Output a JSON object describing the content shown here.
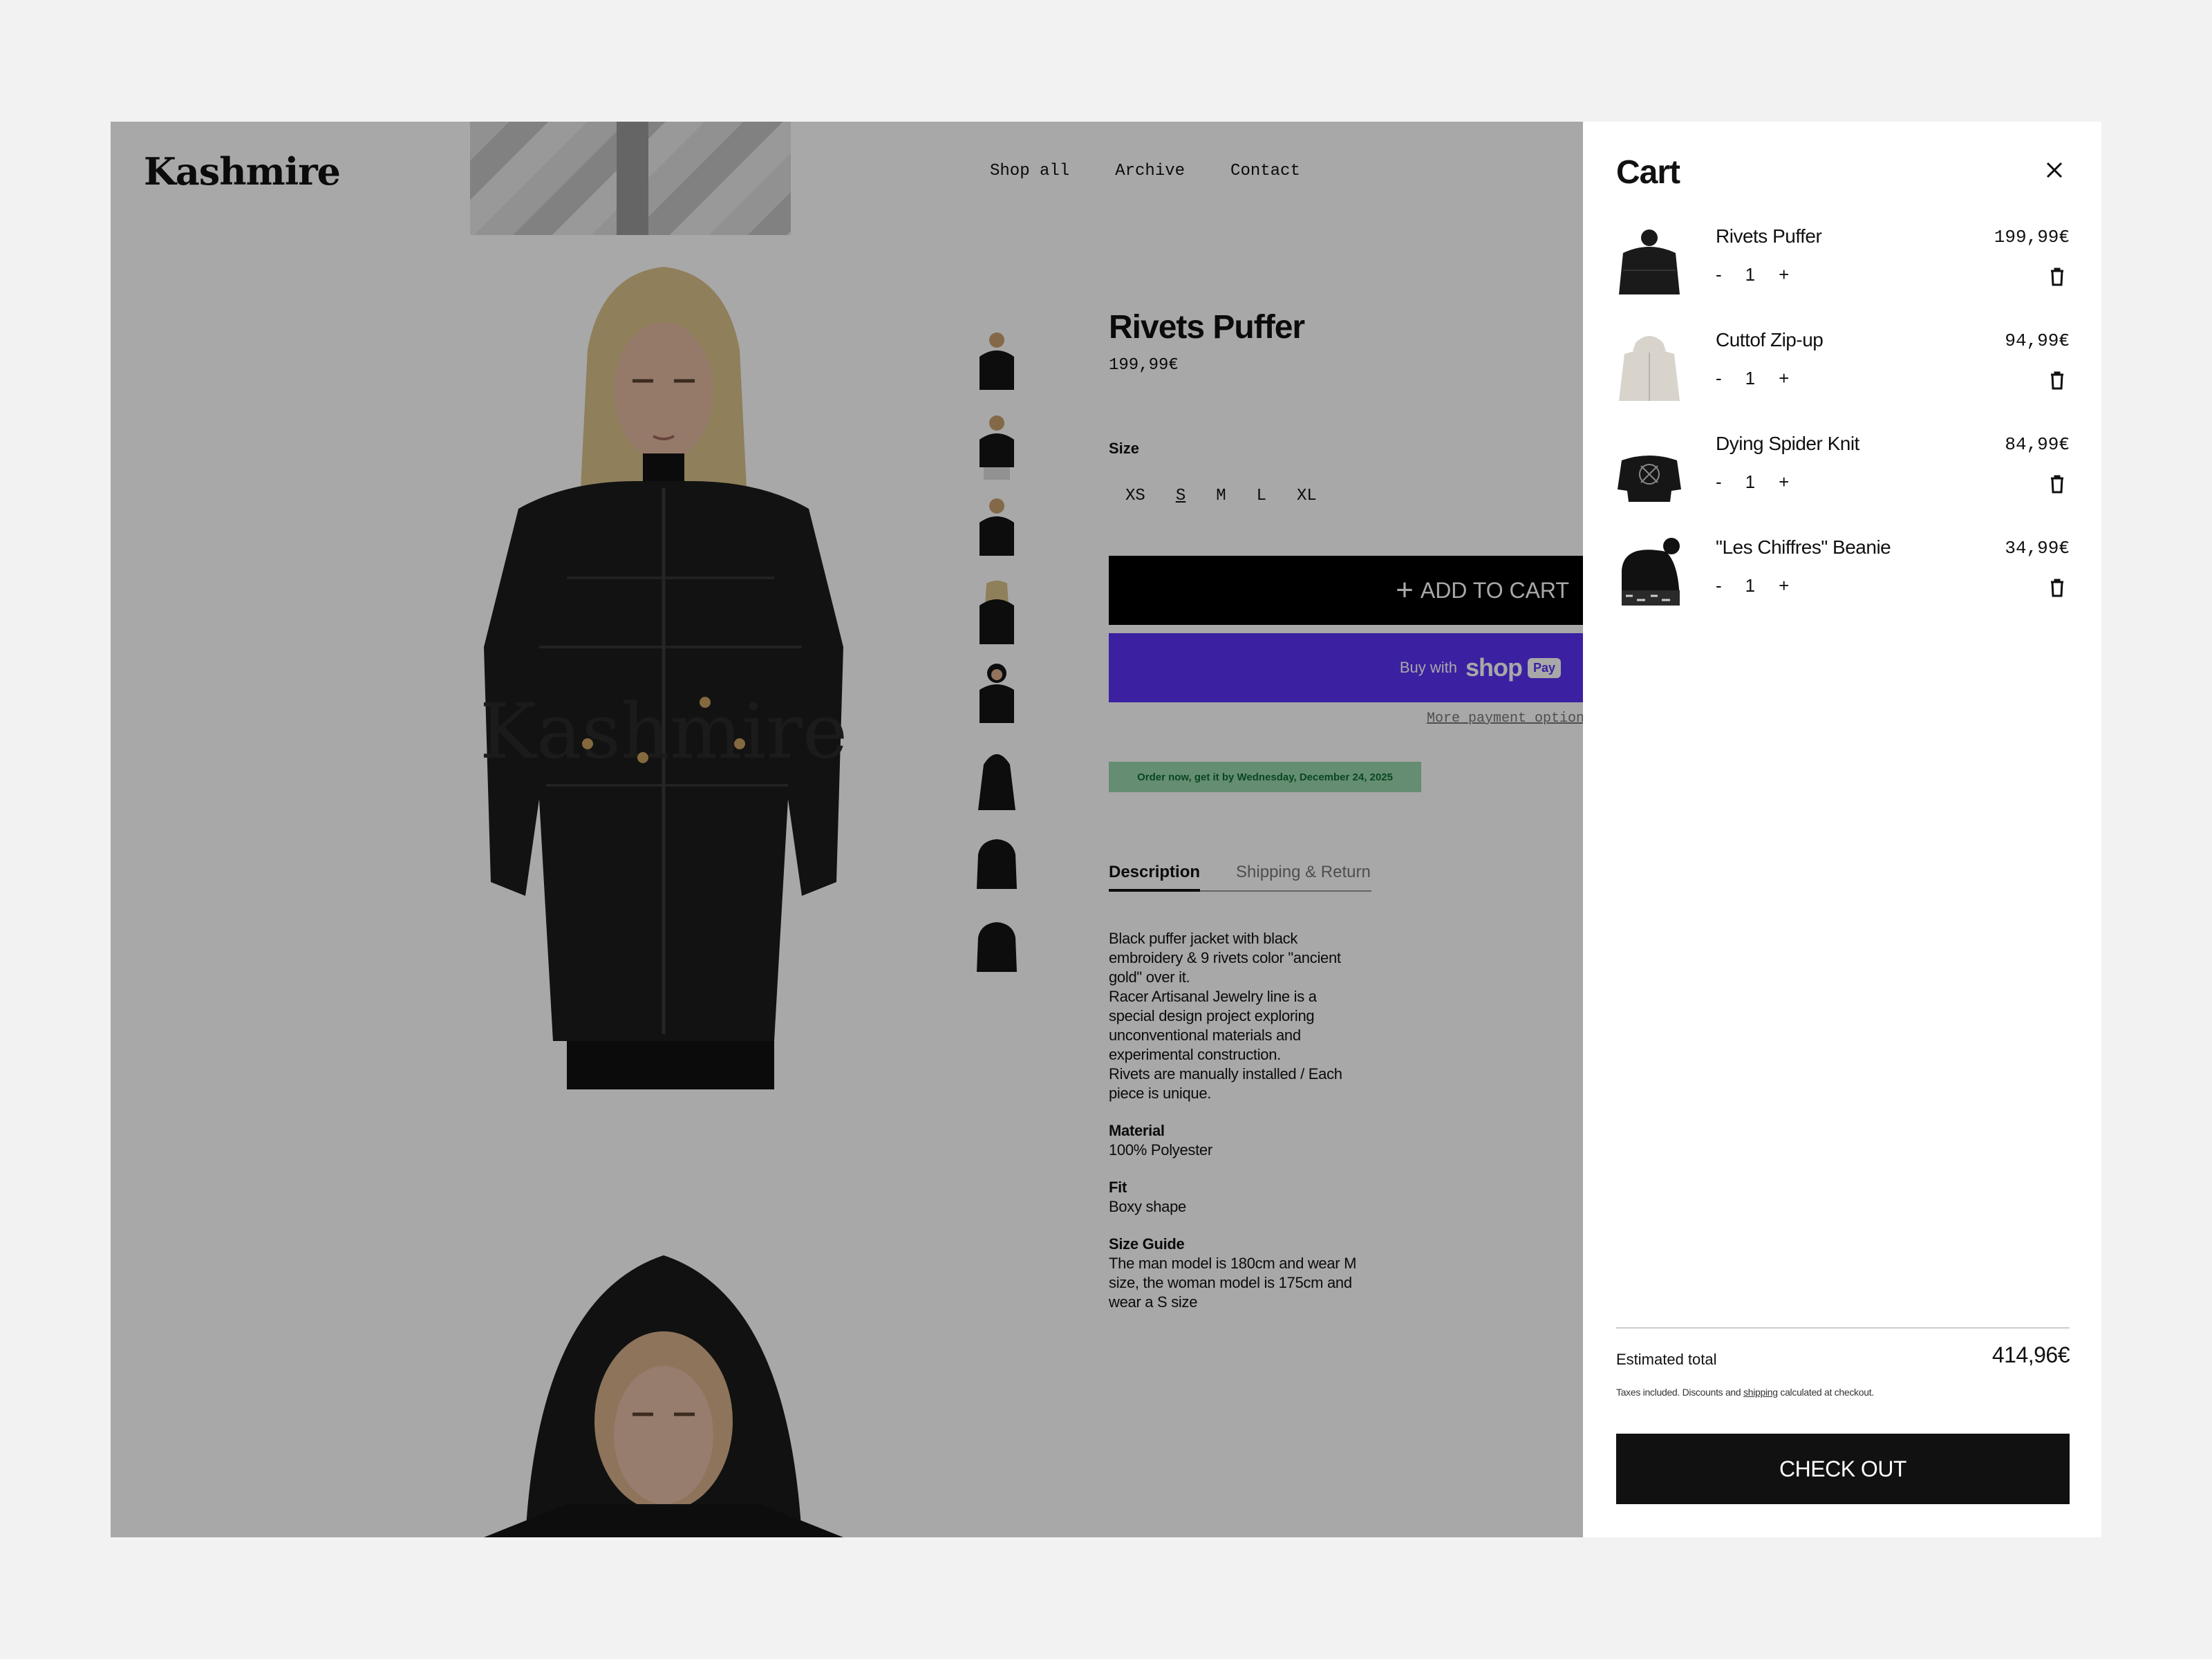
{
  "brand": {
    "logo": "Kashmire"
  },
  "nav": {
    "items": [
      "Shop all",
      "Archive",
      "Contact"
    ]
  },
  "product": {
    "title": "Rivets Puffer",
    "price": "199,99€",
    "size_label": "Size",
    "sizes": [
      "XS",
      "S",
      "M",
      "L",
      "XL"
    ],
    "selected_size": "S",
    "add_to_cart": "ADD TO CART",
    "shop_pay": {
      "prefix": "Buy with",
      "brand": "shop",
      "badge": "Pay"
    },
    "more_payment_options": "More payment options",
    "order_now": "Order now, get it by Wednesday, December 24, 2025",
    "tabs": [
      "Description",
      "Shipping & Return"
    ],
    "active_tab": "Description",
    "description": [
      "Black puffer jacket with black embroidery & 9 rivets color \"ancient gold\" over it.",
      "Racer Artisanal Jewelry line is a special design project exploring unconventional materials and experimental construction.",
      "Rivets are manually installed / Each piece is unique."
    ],
    "material_label": "Material",
    "material": "100% Polyester",
    "fit_label": "Fit",
    "fit": "Boxy shape",
    "size_guide_label": "Size Guide",
    "size_guide": "The man model is 180cm and wear M size, the woman model is 175cm and wear a S size"
  },
  "cart": {
    "title": "Cart",
    "items": [
      {
        "name": "Rivets Puffer",
        "price": "199,99€",
        "qty": "1",
        "image": "puffer-jacket"
      },
      {
        "name": "Cuttof Zip-up",
        "price": "94,99€",
        "qty": "1",
        "image": "grey-zip-hoodie"
      },
      {
        "name": "Dying Spider Knit",
        "price": "84,99€",
        "qty": "1",
        "image": "black-knit-sweater"
      },
      {
        "name": "\"Les Chiffres\" Beanie",
        "price": "34,99€",
        "qty": "1",
        "image": "black-beanie"
      }
    ],
    "minus": "-",
    "plus": "+",
    "estimated_total_label": "Estimated total",
    "estimated_total": "414,96€",
    "tax_note_pre": "Taxes included. Discounts and",
    "tax_note_link": "shipping",
    "tax_note_post": "calculated at checkout.",
    "checkout": "CHECK OUT"
  },
  "colors": {
    "shop_pay": "#5a31f4",
    "order_now_bg": "#9ad6ac",
    "order_now_text": "#0e6b34",
    "overlay": "rgba(0,0,0,0.34)"
  },
  "icons": [
    "close-icon",
    "trash-icon",
    "plus-icon"
  ]
}
